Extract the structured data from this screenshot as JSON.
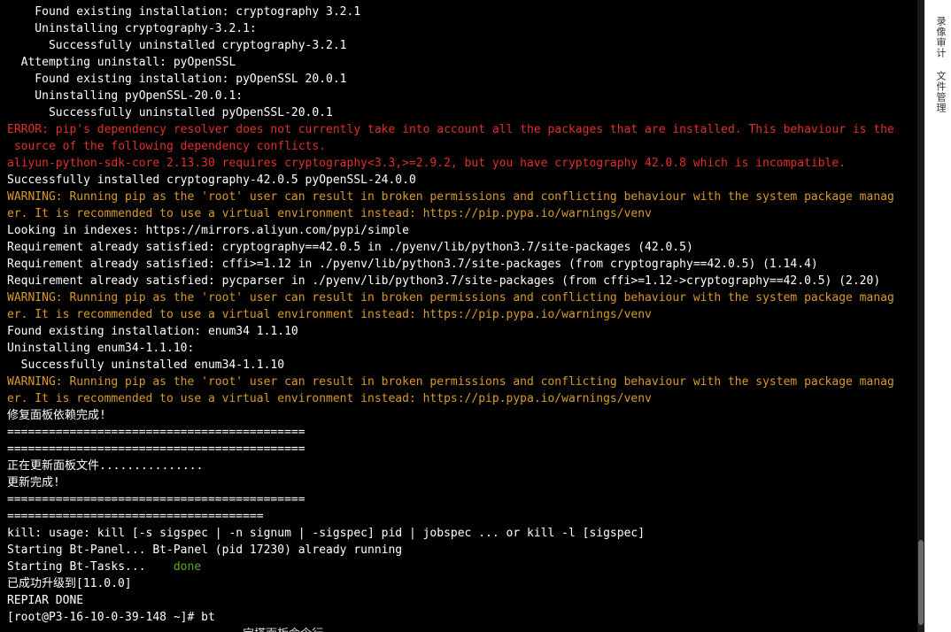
{
  "terminal": {
    "lines": [
      {
        "text": "    Found existing installation: cryptography 3.2.1",
        "kind": "normal"
      },
      {
        "text": "    Uninstalling cryptography-3.2.1:",
        "kind": "normal"
      },
      {
        "text": "      Successfully uninstalled cryptography-3.2.1",
        "kind": "normal"
      },
      {
        "text": "  Attempting uninstall: pyOpenSSL",
        "kind": "normal"
      },
      {
        "text": "    Found existing installation: pyOpenSSL 20.0.1",
        "kind": "normal"
      },
      {
        "text": "    Uninstalling pyOpenSSL-20.0.1:",
        "kind": "normal"
      },
      {
        "text": "      Successfully uninstalled pyOpenSSL-20.0.1",
        "kind": "normal"
      },
      {
        "text": "ERROR: pip's dependency resolver does not currently take into account all the packages that are installed. This behaviour is the",
        "kind": "error"
      },
      {
        "text": " source of the following dependency conflicts.",
        "kind": "error"
      },
      {
        "text": "aliyun-python-sdk-core 2.13.30 requires cryptography<3.3,>=2.9.2, but you have cryptography 42.0.8 which is incompatible.",
        "kind": "error"
      },
      {
        "text": "Successfully installed cryptography-42.0.5 pyOpenSSL-24.0.0",
        "kind": "normal"
      },
      {
        "text": "WARNING: Running pip as the 'root' user can result in broken permissions and conflicting behaviour with the system package manag",
        "kind": "warning"
      },
      {
        "text": "er. It is recommended to use a virtual environment instead: https://pip.pypa.io/warnings/venv",
        "kind": "warning"
      },
      {
        "text": "Looking in indexes: https://mirrors.aliyun.com/pypi/simple",
        "kind": "normal"
      },
      {
        "text": "Requirement already satisfied: cryptography==42.0.5 in ./pyenv/lib/python3.7/site-packages (42.0.5)",
        "kind": "normal"
      },
      {
        "text": "Requirement already satisfied: cffi>=1.12 in ./pyenv/lib/python3.7/site-packages (from cryptography==42.0.5) (1.14.4)",
        "kind": "normal"
      },
      {
        "text": "Requirement already satisfied: pycparser in ./pyenv/lib/python3.7/site-packages (from cffi>=1.12->cryptography==42.0.5) (2.20)",
        "kind": "normal"
      },
      {
        "text": "WARNING: Running pip as the 'root' user can result in broken permissions and conflicting behaviour with the system package manag",
        "kind": "warning"
      },
      {
        "text": "er. It is recommended to use a virtual environment instead: https://pip.pypa.io/warnings/venv",
        "kind": "warning"
      },
      {
        "text": "Found existing installation: enum34 1.1.10",
        "kind": "normal"
      },
      {
        "text": "Uninstalling enum34-1.1.10:",
        "kind": "normal"
      },
      {
        "text": "  Successfully uninstalled enum34-1.1.10",
        "kind": "normal"
      },
      {
        "text": "WARNING: Running pip as the 'root' user can result in broken permissions and conflicting behaviour with the system package manag",
        "kind": "warning"
      },
      {
        "text": "er. It is recommended to use a virtual environment instead: https://pip.pypa.io/warnings/venv",
        "kind": "warning"
      },
      {
        "text": "修复面板依赖完成!",
        "kind": "normal"
      },
      {
        "text": "===========================================",
        "kind": "normal"
      },
      {
        "text": "===========================================",
        "kind": "normal"
      },
      {
        "text": "正在更新面板文件...............",
        "kind": "normal"
      },
      {
        "text": "更新完成!",
        "kind": "normal"
      },
      {
        "text": "===========================================",
        "kind": "normal"
      },
      {
        "text": "=====================================",
        "kind": "normal"
      },
      {
        "text": "kill: usage: kill [-s sigspec | -n signum | -sigspec] pid | jobspec ... or kill -l [sigspec]",
        "kind": "normal"
      },
      {
        "text": "Starting Bt-Panel... Bt-Panel (pid 17230) already running",
        "kind": "normal"
      },
      {
        "text": "Starting Bt-Tasks...    ",
        "kind": "normal",
        "suffix": "done"
      },
      {
        "text": "已成功升级到[11.0.0]",
        "kind": "normal"
      },
      {
        "text": "REPIAR DONE",
        "kind": "normal"
      },
      {
        "text": "[root@P3-16-10-0-39-148 ~]# bt",
        "kind": "normal"
      },
      {
        "text": "                                  宝塔面板命令行",
        "kind": "cut"
      }
    ]
  },
  "side_panel": {
    "record_audit_label": "录像审计",
    "file_manager_label": "文件管理"
  },
  "colors": {
    "error": "#e0302b",
    "warning": "#d99a2b",
    "done": "#5fa81b",
    "background": "#000000",
    "text": "#ffffff"
  }
}
